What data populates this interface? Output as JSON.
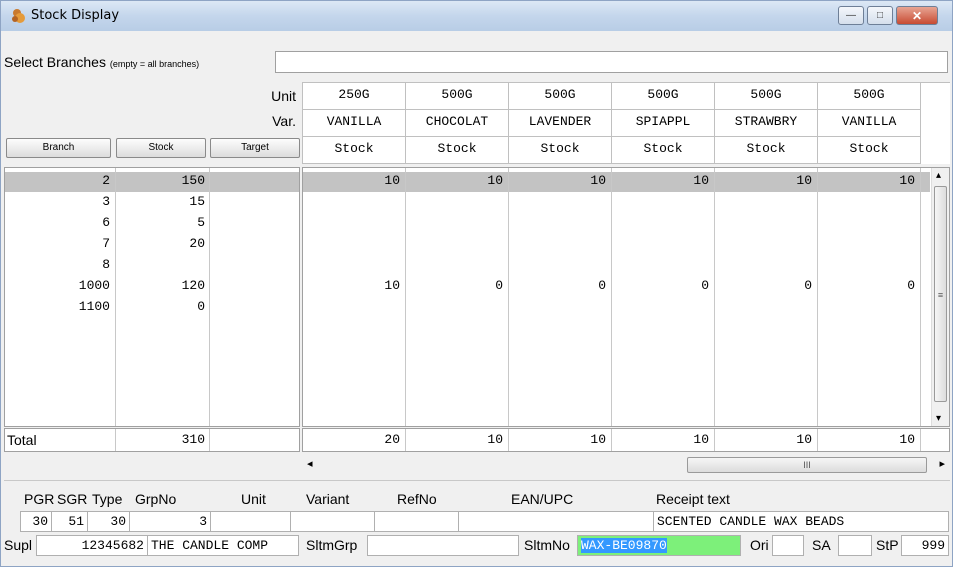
{
  "window": {
    "title": "Stock Display",
    "controls": {
      "min": "—",
      "max": "□",
      "close": "✕"
    }
  },
  "select_branches": {
    "label": "Select Branches",
    "hint": "(empty = all branches)",
    "value": ""
  },
  "header": {
    "unit_label": "Unit",
    "var_label": "Var.",
    "buttons": [
      "Branch",
      "Stock",
      "Target"
    ],
    "columns": [
      {
        "unit": "250G",
        "var": "VANILLA",
        "kind": "Stock"
      },
      {
        "unit": "500G",
        "var": "CHOCOLAT",
        "kind": "Stock"
      },
      {
        "unit": "500G",
        "var": "LAVENDER",
        "kind": "Stock"
      },
      {
        "unit": "500G",
        "var": "SPIAPPL",
        "kind": "Stock"
      },
      {
        "unit": "500G",
        "var": "STRAWBRY",
        "kind": "Stock"
      },
      {
        "unit": "500G",
        "var": "VANILLA",
        "kind": "Stock"
      }
    ]
  },
  "rows": [
    {
      "branch": "2",
      "stock": "150",
      "target": "",
      "values": [
        "10",
        "10",
        "10",
        "10",
        "10",
        "10"
      ]
    },
    {
      "branch": "3",
      "stock": "15",
      "target": "",
      "values": [
        "",
        "",
        "",
        "",
        "",
        ""
      ]
    },
    {
      "branch": "6",
      "stock": "5",
      "target": "",
      "values": [
        "",
        "",
        "",
        "",
        "",
        ""
      ]
    },
    {
      "branch": "7",
      "stock": "20",
      "target": "",
      "values": [
        "",
        "",
        "",
        "",
        "",
        ""
      ]
    },
    {
      "branch": "8",
      "stock": "",
      "target": "",
      "values": [
        "",
        "",
        "",
        "",
        "",
        ""
      ]
    },
    {
      "branch": "1000",
      "stock": "120",
      "target": "",
      "values": [
        "10",
        "0",
        "0",
        "0",
        "0",
        "0"
      ]
    },
    {
      "branch": "1100",
      "stock": "0",
      "target": "",
      "values": [
        "",
        "",
        "",
        "",
        "",
        ""
      ]
    }
  ],
  "total": {
    "label": "Total",
    "stock": "310",
    "values": [
      "20",
      "10",
      "10",
      "10",
      "10",
      "10"
    ]
  },
  "hscroll": {
    "left": "◂",
    "right": "▸",
    "grip": "III"
  },
  "vscroll": {
    "up": "▴",
    "down": "▾",
    "grip": "≡"
  },
  "detail": {
    "headers": [
      "PGR",
      "SGR",
      "Type",
      "GrpNo",
      "Unit",
      "Variant",
      "RefNo",
      "EAN/UPC",
      "Receipt text"
    ],
    "pgr": "30",
    "sgr": "51",
    "type": "30",
    "grpno": "3",
    "unit": "",
    "variant": "",
    "refno": "",
    "ean": "",
    "receipt_text": "SCENTED CANDLE WAX BEADS",
    "supl_label": "Supl",
    "supl_no": "12345682",
    "supl_name": "THE CANDLE COMP",
    "sltmgrp_label": "SltmGrp",
    "sltmgrp": "",
    "sltmno_label": "SltmNo",
    "sltmno": "WAX-BE09870",
    "ori_label": "Ori",
    "ori": "",
    "sa_label": "SA",
    "sa": "",
    "stp_label": "StP",
    "stp": "999"
  }
}
